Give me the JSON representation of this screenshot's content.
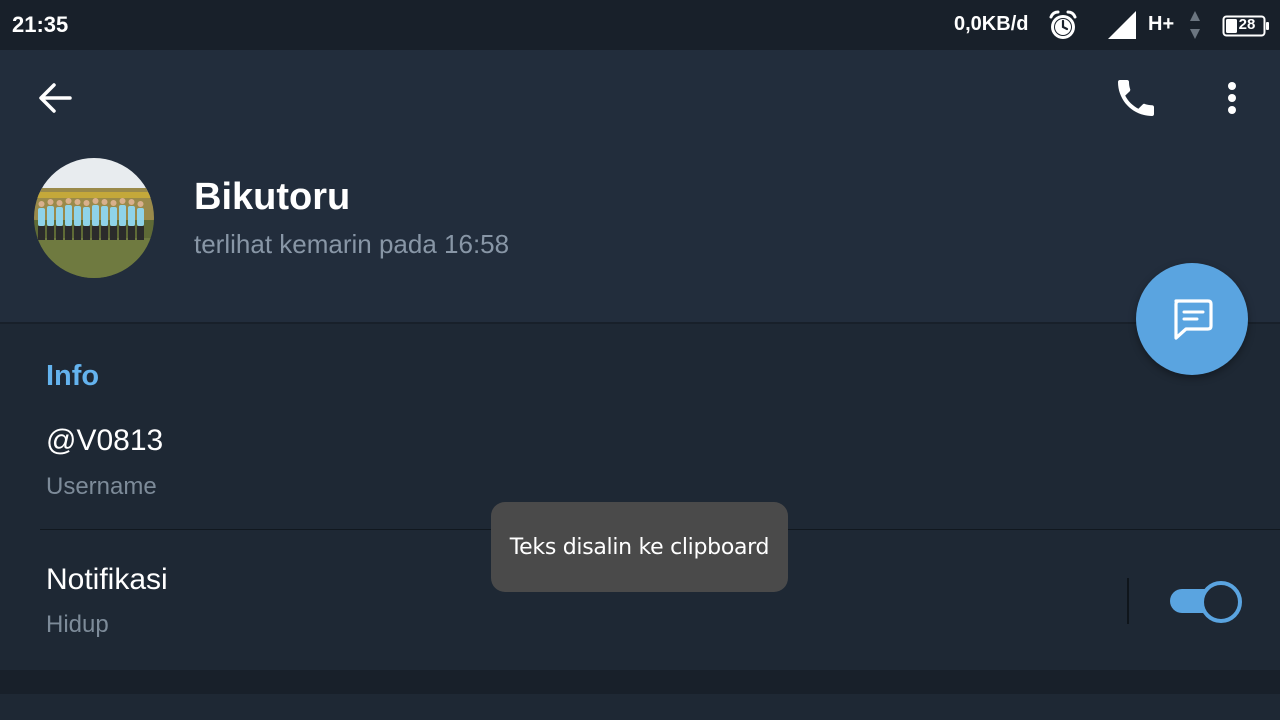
{
  "status_bar": {
    "time": "21:35",
    "speed": "0,0KB/d",
    "network": "H+",
    "battery": "28",
    "icons": [
      "alarm-clock-icon",
      "signal-icon",
      "data-arrows-icon",
      "battery-icon"
    ]
  },
  "toolbar": {
    "icons": [
      "back-arrow-icon",
      "phone-icon",
      "more-vert-icon"
    ]
  },
  "profile": {
    "name": "Bikutoru",
    "status": "terlihat kemarin pada  16:58"
  },
  "fab": {
    "icon": "message-icon"
  },
  "info": {
    "title": "Info",
    "username_value": "@V0813",
    "username_label": "Username",
    "notifications_title": "Notifikasi",
    "notifications_value": "Hidup",
    "notifications_enabled": true
  },
  "toast": {
    "text": "Teks disalin ke clipboard"
  },
  "colors": {
    "accent": "#5aa4e0",
    "section_title": "#64b3ee",
    "background": "#1d2733",
    "header": "#222d3c",
    "toast": "#4a4a4a"
  }
}
